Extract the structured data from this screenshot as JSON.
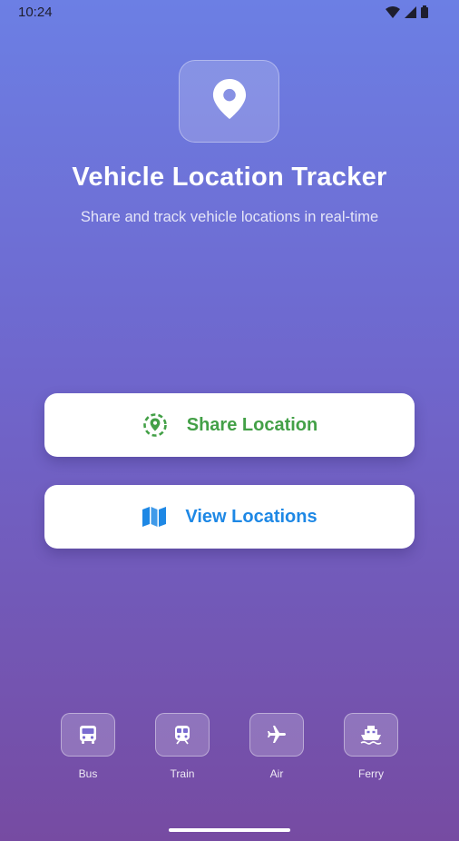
{
  "status_bar": {
    "time": "10:24"
  },
  "header": {
    "title": "Vehicle Location Tracker",
    "subtitle": "Share and track vehicle locations in real-time",
    "logo_icon": "location-pin-icon"
  },
  "actions": {
    "share": {
      "label": "Share Location",
      "icon": "share-location-icon",
      "color": "#43a047"
    },
    "view": {
      "label": "View Locations",
      "icon": "map-icon",
      "color": "#1e88e5"
    }
  },
  "vehicles": [
    {
      "label": "Bus",
      "icon": "bus-icon"
    },
    {
      "label": "Train",
      "icon": "train-icon"
    },
    {
      "label": "Air",
      "icon": "airplane-icon"
    },
    {
      "label": "Ferry",
      "icon": "ferry-icon"
    }
  ],
  "colors": {
    "gradient_top": "#6c7fe4",
    "gradient_bottom": "#764ba2"
  }
}
